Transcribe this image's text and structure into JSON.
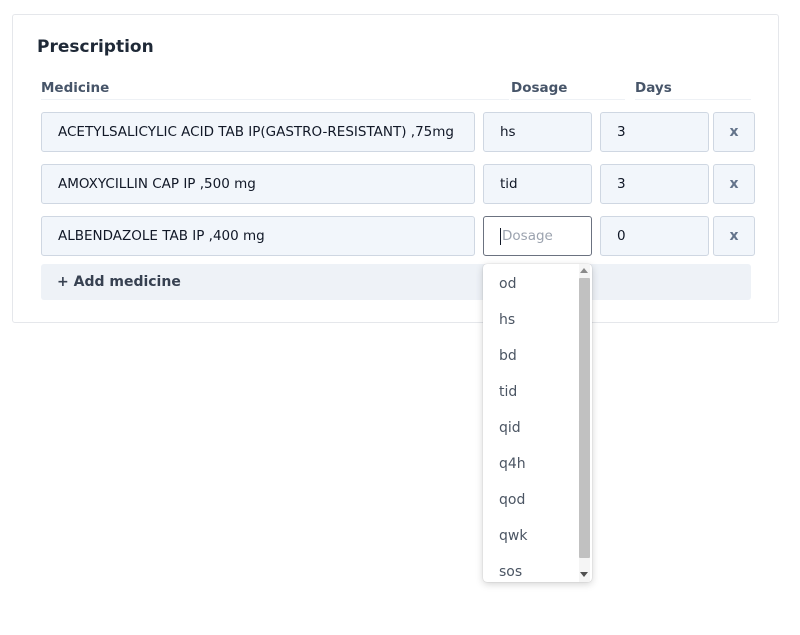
{
  "prescription": {
    "title": "Prescription",
    "columns": {
      "medicine": "Medicine",
      "dosage": "Dosage",
      "days": "Days"
    },
    "rows": [
      {
        "medicine": "ACETYLSALICYLIC ACID TAB IP(GASTRO-RESISTANT) ,75mg",
        "dosage": "hs",
        "days": "3",
        "remove": "x"
      },
      {
        "medicine": "AMOXYCILLIN CAP IP ,500 mg",
        "dosage": "tid",
        "days": "3",
        "remove": "x"
      },
      {
        "medicine": "ALBENDAZOLE TAB IP ,400 mg",
        "dosage": "",
        "dosage_placeholder": "Dosage",
        "days": "0",
        "remove": "x"
      }
    ],
    "add_button": "+ Add medicine"
  },
  "dosage_dropdown": {
    "options": [
      "od",
      "hs",
      "bd",
      "tid",
      "qid",
      "q4h",
      "qod",
      "qwk",
      "sos"
    ]
  }
}
